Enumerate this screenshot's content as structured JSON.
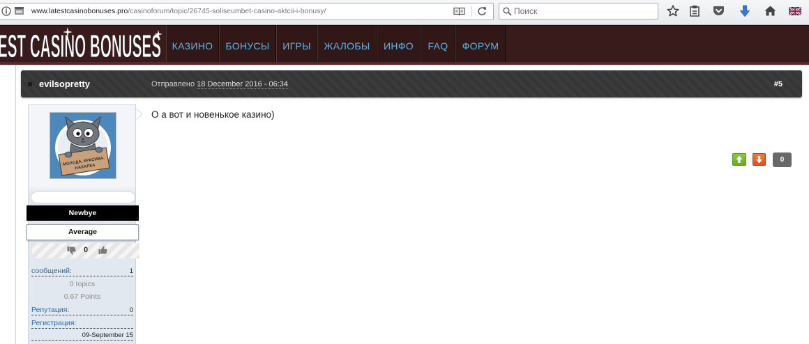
{
  "browser": {
    "url_host": "www.latestcasinobonuses.pro",
    "url_path": "/casinoforum/topic/26745-soliseumbet-casino-aktcii-i-bonusy/",
    "search_placeholder": "Поиск",
    "icons": [
      "site-info-icon",
      "page-icon",
      "reader-view-icon",
      "reload-icon",
      "search-icon",
      "bookmark-star-icon",
      "reading-list-icon",
      "pocket-icon",
      "download-icon",
      "home-icon",
      "uk-flag-icon"
    ]
  },
  "site": {
    "logo_text": "EST CASINO BONUSES",
    "nav": [
      {
        "label": "КАЗИНО"
      },
      {
        "label": "БОНУСЫ"
      },
      {
        "label": "ИГРЫ"
      },
      {
        "label": "ЖАЛОБЫ"
      },
      {
        "label": "ИНФО"
      },
      {
        "label": "FAQ"
      },
      {
        "label": "ФОРУМ"
      }
    ]
  },
  "post": {
    "author": "evilsopretty",
    "posted_label": "Отправлено",
    "posted_date": "18 December 2016 - 06:34",
    "post_number": "#5",
    "body": "О а вот и новенькое казино)",
    "vote_count": "0"
  },
  "author_card": {
    "avatar_sign": [
      "МОЛОДА, КРАСИВА,",
      "НАХАЛКА"
    ],
    "rank": "Newbye",
    "level": "Average",
    "reputation_count": "0",
    "posts_label": "сообщений:",
    "posts_value": "1",
    "topics": "0 topics",
    "points": "0.67 Points",
    "reputation_label": "Репутация:",
    "reputation_value": "0",
    "joined_label": "Регистрация:",
    "joined_value": "09-September 15"
  },
  "colors": {
    "header-bg": "#3a1b1b",
    "nav-text": "#58b4e8",
    "post-bar": "#363636",
    "link-blue": "#2a6cb3",
    "vote-up": "#6aaa22",
    "vote-down": "#e0501c",
    "vote-count": "#686868",
    "rank-bg": "#000000"
  }
}
